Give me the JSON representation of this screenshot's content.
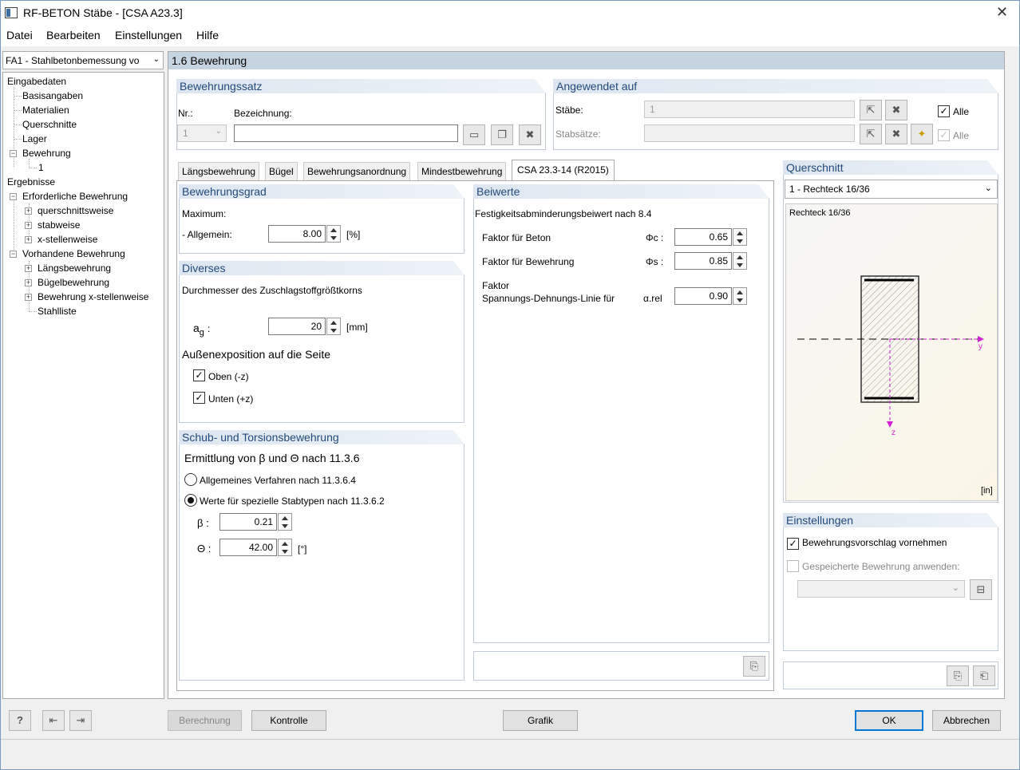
{
  "window": {
    "title": "RF-BETON Stäbe - [CSA A23.3]",
    "close_glyph": "✕"
  },
  "menu": [
    "Datei",
    "Bearbeiten",
    "Einstellungen",
    "Hilfe"
  ],
  "nav": {
    "combo": "FA1 - Stahlbetonbemessung vo",
    "items": {
      "eingabedaten": "Eingabedaten",
      "basisangaben": "Basisangaben",
      "materialien": "Materialien",
      "querschnitte": "Querschnitte",
      "lager": "Lager",
      "bewehrung": "Bewehrung",
      "bewehrung_1": "1",
      "ergebnisse": "Ergebnisse",
      "erforderliche": "Erforderliche Bewehrung",
      "querschnittsweise": "querschnittsweise",
      "stabweise": "stabweise",
      "xstellenweise": "x-stellenweise",
      "vorhandene": "Vorhandene Bewehrung",
      "laengsbewehrung": "Längsbewehrung",
      "buegelbewehrung": "Bügelbewehrung",
      "bewehrung_x": "Bewehrung x-stellenweise",
      "stahlliste": "Stahlliste"
    }
  },
  "page_title": "1.6 Bewehrung",
  "bewehrungssatz": {
    "title": "Bewehrungssatz",
    "nr_label": "Nr.:",
    "nr_value": "1",
    "bez_label": "Bezeichnung:",
    "bez_value": ""
  },
  "angewendet": {
    "title": "Angewendet auf",
    "staebe_label": "Stäbe:",
    "staebe_value": "1",
    "alle_label": "Alle",
    "stabsaetze_label": "Stabsätze:",
    "alle2_label": "Alle"
  },
  "tabs": [
    "Längsbewehrung",
    "Bügel",
    "Bewehrungsanordnung",
    "Mindestbewehrung",
    "CSA 23.3-14 (R2015)"
  ],
  "bewehrungsgrad": {
    "title": "Bewehrungsgrad",
    "maximum": "Maximum:",
    "allgemein_label": "- Allgemein:",
    "allgemein_value": "8.00",
    "unit": "[%]"
  },
  "diverses": {
    "title": "Diverses",
    "durchmesser": "Durchmesser des Zuschlagstoffgrößtkorns",
    "ag_label": "a",
    "ag_sub": "g",
    "ag_colon": ":",
    "ag_value": "20",
    "ag_unit": "[mm]",
    "aussen": "Außenexposition auf die Seite",
    "oben": "Oben (-z)",
    "unten": "Unten (+z)",
    "check_glyph": "✓"
  },
  "schub": {
    "title": "Schub- und Torsionsbewehrung",
    "ermittlung": "Ermittlung von β und Θ nach 11.3.6",
    "r1": "Allgemeines Verfahren nach 11.3.6.4",
    "r2": "Werte für spezielle Stabtypen nach 11.3.6.2",
    "beta_label": "β :",
    "beta_value": "0.21",
    "theta_label": "Θ :",
    "theta_value": "42.00",
    "theta_unit": "[°]"
  },
  "beiwerte": {
    "title": "Beiwerte",
    "fest": "Festigkeitsabminderungsbeiwert nach 8.4",
    "beton_label": "Faktor für Beton",
    "beton_sym": "Φc :",
    "beton_value": "0.65",
    "bew_label": "Faktor für Bewehrung",
    "bew_sym": "Φs :",
    "bew_value": "0.85",
    "faktor": "Faktor",
    "spann": "Spannungs-Dehnungs-Linie für",
    "alpha_sym": "α.rel",
    "alpha_value": "0.90"
  },
  "querschnitt": {
    "title": "Querschnitt",
    "combo": "1 - Rechteck 16/36",
    "caption": "Rechteck 16/36",
    "axis_y": "y",
    "axis_z": "z",
    "unit": "[in]"
  },
  "einstellungen": {
    "title": "Einstellungen",
    "vorschlag": "Bewehrungsvorschlag vornehmen",
    "gespeichert": "Gespeicherte Bewehrung anwenden:"
  },
  "buttons": {
    "berechnung": "Berechnung",
    "kontrolle": "Kontrolle",
    "grafik": "Grafik",
    "ok": "OK",
    "abbrechen": "Abbrechen"
  }
}
